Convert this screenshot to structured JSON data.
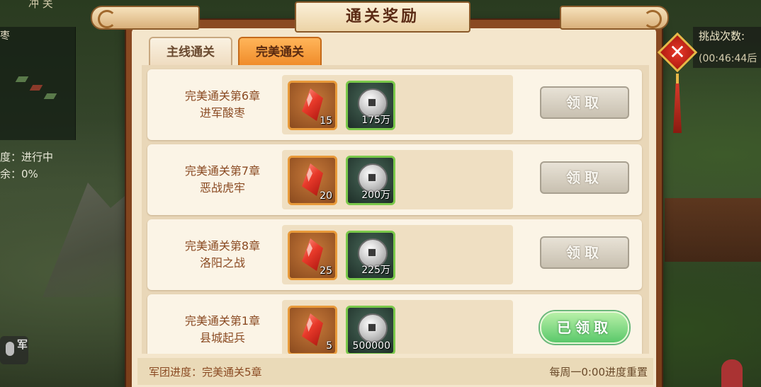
{
  "dialog": {
    "title": "通关奖励",
    "tabs": [
      {
        "label": "主线通关",
        "active": false
      },
      {
        "label": "完美通关",
        "active": true
      }
    ],
    "rewards": [
      {
        "title_line1": "完美通关第6章",
        "title_line2": "进军酸枣",
        "crystal_qty": "15",
        "coin_qty": "175万",
        "button": "领取",
        "claimed": false
      },
      {
        "title_line1": "完美通关第7章",
        "title_line2": "恶战虎牢",
        "crystal_qty": "20",
        "coin_qty": "200万",
        "button": "领取",
        "claimed": false
      },
      {
        "title_line1": "完美通关第8章",
        "title_line2": "洛阳之战",
        "crystal_qty": "25",
        "coin_qty": "225万",
        "button": "领取",
        "claimed": false
      },
      {
        "title_line1": "完美通关第1章",
        "title_line2": "县城起兵",
        "crystal_qty": "5",
        "coin_qty": "500000",
        "button": "已领取",
        "claimed": true
      }
    ],
    "footer": {
      "progress": "军团进度：完美通关5章",
      "reset_note": "每周一0:00进度重置"
    }
  },
  "background": {
    "left_info_line1": "度：进行中",
    "left_info_line2": "余：0%",
    "top_left_text": "冲 关",
    "minimap_label": "枣",
    "mic_text": "军",
    "right_text1": "挑战次数:",
    "right_text2": "(00:46:44后"
  },
  "icons": {
    "close": "close-icon",
    "crystal": "red-crystal-icon",
    "coin": "silver-coin-icon",
    "mic": "microphone-icon"
  },
  "colors": {
    "active_tab": "#f08c2a",
    "claimed_button": "#5ac86a",
    "close_button": "#e83a2a"
  }
}
